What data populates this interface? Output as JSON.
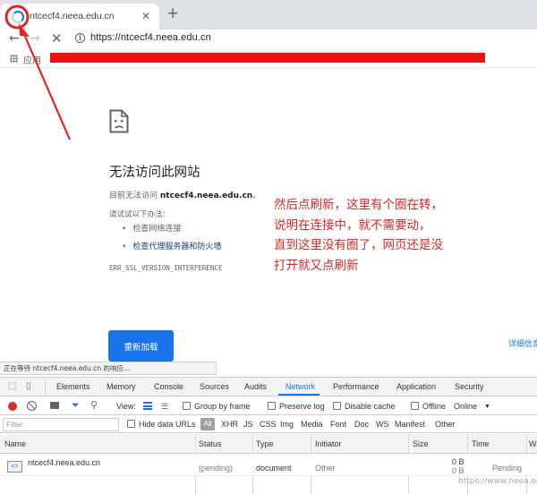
{
  "browser": {
    "tab_title": "ntcecf4.neea.edu.cn",
    "tab_close_glyph": "✕",
    "new_tab_glyph": "+",
    "url": "https://ntcecf4.neea.edu.cn",
    "nav_icons": {
      "back": "←",
      "forward": "→",
      "stop": "✕",
      "info": "i"
    },
    "bookmarks_apps_label": "应用",
    "redaction_color": "#ee1111"
  },
  "error_page": {
    "title": "无法访问此网站",
    "line_prefix": "目前无法访问",
    "domain": "ntcecf4.neea.edu.cn",
    "line_suffix": "。",
    "try_label": "请试试以下办法：",
    "suggestions": [
      "检查网络连接",
      "检查代理服务器和防火墙"
    ],
    "error_code": "ERR_SSL_VERSION_INTERFERENCE",
    "reload_button": "重新加载",
    "details_link": "详细信息"
  },
  "annotation": {
    "lines": [
      "然后点刷新，这里有个圈在转，",
      "说明在连接中，就不需要动，",
      "直到这里没有圈了，网页还是没",
      "打开就又点刷新"
    ],
    "color": "#cc2a2a"
  },
  "status_bar": "正在等待 ntcecf4.neea.edu.cn 的响应...",
  "devtools": {
    "tabs": [
      "Elements",
      "Memory",
      "Console",
      "Sources",
      "Audits",
      "Network",
      "Performance",
      "Application",
      "Security"
    ],
    "active_tab": "Network",
    "controls": {
      "view_label": "View:",
      "group_by_frame": "Group by frame",
      "preserve_log": "Preserve log",
      "disable_cache": "Disable cache",
      "offline": "Offline",
      "online": "Online"
    },
    "filter_placeholder": "Filter",
    "hide_data_urls": "Hide data URLs",
    "type_filters": [
      "All",
      "XHR",
      "JS",
      "CSS",
      "Img",
      "Media",
      "Font",
      "Doc",
      "WS",
      "Manifest",
      "Other"
    ],
    "columns": [
      "Name",
      "Status",
      "Type",
      "Initiator",
      "Size",
      "Time",
      "W"
    ],
    "rows": [
      {
        "name": "ntcecf4.neea.edu.cn",
        "status": "(pending)",
        "type": "document",
        "initiator": "Other",
        "size_top": "0 B",
        "size_bottom": "0 B",
        "time": "Pending"
      }
    ]
  },
  "watermark": "https://www.neea.edu.cn"
}
